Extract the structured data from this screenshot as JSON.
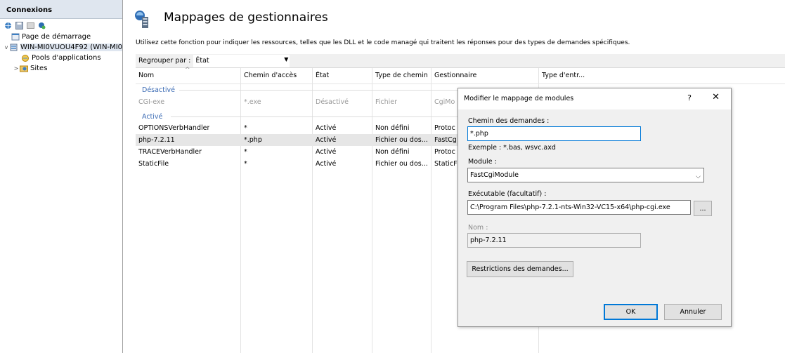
{
  "connections": {
    "title": "Connexions",
    "tree": [
      {
        "label": "Page de démarrage",
        "level": 1,
        "expander": ""
      },
      {
        "label": "WIN-MI0VUOU4F92 (WIN-MI0",
        "level": 0,
        "expander": "v"
      },
      {
        "label": "Pools d'applications",
        "level": 2,
        "expander": ""
      },
      {
        "label": "Sites",
        "level": 1,
        "expander": ">"
      }
    ]
  },
  "page": {
    "title": "Mappages de gestionnaires",
    "description": "Utilisez cette fonction pour indiquer les ressources, telles que les DLL et le code managé qui traitent les réponses pour des types de demandes spécifiques.",
    "group_by_label": "Regrouper par :",
    "group_by_value": "État"
  },
  "grid": {
    "columns": [
      "Nom",
      "Chemin d'accès",
      "État",
      "Type de chemin",
      "Gestionnaire",
      "Type d'entr..."
    ],
    "groups": [
      {
        "label": "Désactivé",
        "rows": [
          {
            "name": "CGI-exe",
            "path": "*.exe",
            "state": "Désactivé",
            "type": "Fichier",
            "handler": "CgiMo"
          }
        ]
      },
      {
        "label": "Activé",
        "rows": [
          {
            "name": "OPTIONSVerbHandler",
            "path": "*",
            "state": "Activé",
            "type": "Non défini",
            "handler": "Protoc"
          },
          {
            "name": "php-7.2.11",
            "path": "*.php",
            "state": "Activé",
            "type": "Fichier ou dos...",
            "handler": "FastCg"
          },
          {
            "name": "TRACEVerbHandler",
            "path": "*",
            "state": "Activé",
            "type": "Non défini",
            "handler": "Protoc"
          },
          {
            "name": "StaticFile",
            "path": "*",
            "state": "Activé",
            "type": "Fichier ou dos...",
            "handler": "StaticF"
          }
        ]
      }
    ]
  },
  "dialog": {
    "title": "Modifier le mappage de modules",
    "help": "?",
    "close": "✕",
    "request_path_label": "Chemin des demandes :",
    "request_path_value": "*.php",
    "example": "Exemple : *.bas, wsvc.axd",
    "module_label": "Module :",
    "module_value": "FastCgiModule",
    "executable_label": "Exécutable (facultatif) :",
    "executable_value": "C:\\Program Files\\php-7.2.1-nts-Win32-VC15-x64\\php-cgi.exe",
    "browse_label": "...",
    "name_label": "Nom :",
    "name_value": "php-7.2.11",
    "restrictions_label": "Restrictions des demandes...",
    "ok_label": "OK",
    "cancel_label": "Annuler"
  },
  "colors": {
    "group_header": "#3e6db5",
    "focus_border": "#0078d7",
    "selected_row": "#e6e6e6"
  }
}
